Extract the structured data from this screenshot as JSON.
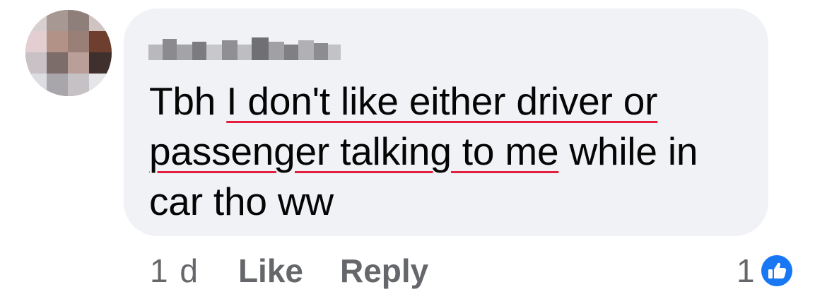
{
  "comment": {
    "author_name": "",
    "text_before": "Tbh ",
    "text_underlined_1": "I don't like either driver or",
    "text_between": " ",
    "text_underlined_2": "passenger talking to me",
    "text_after": " while in car tho ww",
    "underline_color": "#e41e3f",
    "bubble_color": "#f0f2f5"
  },
  "actions": {
    "time": "1 d",
    "like_label": "Like",
    "reply_label": "Reply"
  },
  "reactions": {
    "count": "1",
    "icon": "thumbs-up-icon",
    "icon_color": "#1877f2"
  }
}
